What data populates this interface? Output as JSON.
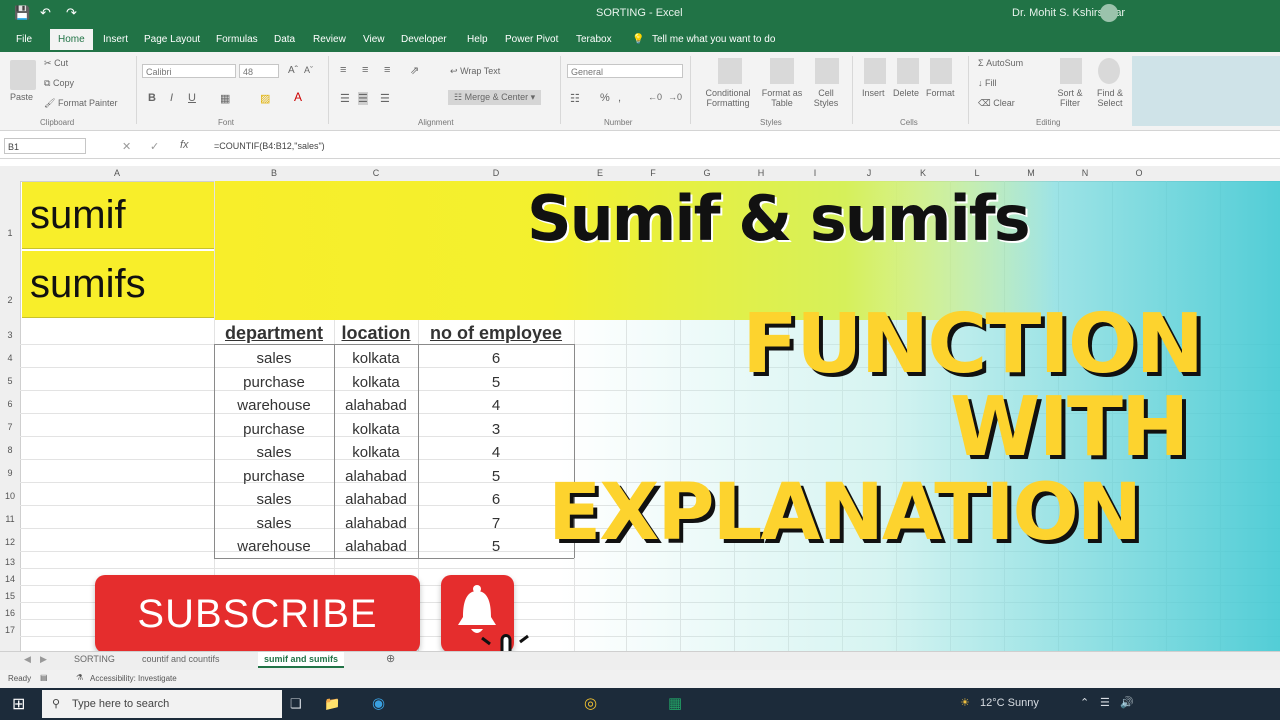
{
  "window": {
    "title": "SORTING - Excel",
    "account": "Dr. Mohit S. Kshirsagar"
  },
  "menu": [
    "File",
    "Home",
    "Insert",
    "Page Layout",
    "Formulas",
    "Data",
    "Review",
    "View",
    "Developer",
    "Help",
    "Power Pivot",
    "Terabox"
  ],
  "tell_me": "Tell me what you want to do",
  "ribbon": {
    "clipboard": {
      "paste": "Paste",
      "cut": "Cut",
      "copy": "Copy",
      "format_painter": "Format Painter",
      "group": "Clipboard"
    },
    "font": {
      "name": "Calibri",
      "size": "48",
      "group": "Font"
    },
    "alignment": {
      "wrap": "Wrap Text",
      "merge": "Merge & Center",
      "group": "Alignment"
    },
    "number": {
      "format": "General",
      "group": "Number"
    },
    "styles": {
      "conditional": "Conditional Formatting",
      "format_table": "Format as Table",
      "cell_styles": "Cell Styles",
      "group": "Styles"
    },
    "cells": {
      "insert": "Insert",
      "delete": "Delete",
      "format": "Format",
      "group": "Cells"
    },
    "editing": {
      "autosum": "AutoSum",
      "fill": "Fill",
      "clear": "Clear",
      "sort": "Sort & Filter",
      "find": "Find & Select",
      "group": "Editing"
    }
  },
  "formula_bar": {
    "cell_ref": "B1",
    "formula": "=COUNTIF(B4:B12,\"sales\")"
  },
  "columns": [
    "A",
    "B",
    "C",
    "D",
    "E",
    "F",
    "G",
    "H",
    "I",
    "J",
    "K",
    "L",
    "M",
    "N",
    "O"
  ],
  "rows": [
    "1",
    "2",
    "3",
    "4",
    "5",
    "6",
    "7",
    "8",
    "9",
    "10",
    "11",
    "12",
    "13",
    "14",
    "15",
    "16",
    "17"
  ],
  "cells": {
    "a1": "sumif",
    "a2": "sumifs"
  },
  "table": {
    "headers": [
      "department",
      "location",
      "no of employee"
    ],
    "rows": [
      [
        "sales",
        "kolkata",
        "6"
      ],
      [
        "purchase",
        "kolkata",
        "5"
      ],
      [
        "warehouse",
        "alahabad",
        "4"
      ],
      [
        "purchase",
        "kolkata",
        "3"
      ],
      [
        "sales",
        "kolkata",
        "4"
      ],
      [
        "purchase",
        "alahabad",
        "5"
      ],
      [
        "sales",
        "alahabad",
        "6"
      ],
      [
        "sales",
        "alahabad",
        "7"
      ],
      [
        "warehouse",
        "alahabad",
        "5"
      ]
    ]
  },
  "overlay": {
    "title": "Sumif  & sumifs",
    "line1": "FUNCTION",
    "line2": "WITH",
    "line3": "EXPLANATION",
    "subscribe": "SUBSCRIBE",
    "title_color": "#111111",
    "accent_color": "#fdd32e",
    "button_color": "#e52d2d"
  },
  "sheets": [
    "SORTING",
    "countif and countifs",
    "sumif and sumifs"
  ],
  "status": {
    "ready": "Ready",
    "accessibility": "Accessibility: Investigate"
  },
  "taskbar": {
    "search": "Type here to search",
    "weather": "12°C Sunny"
  }
}
